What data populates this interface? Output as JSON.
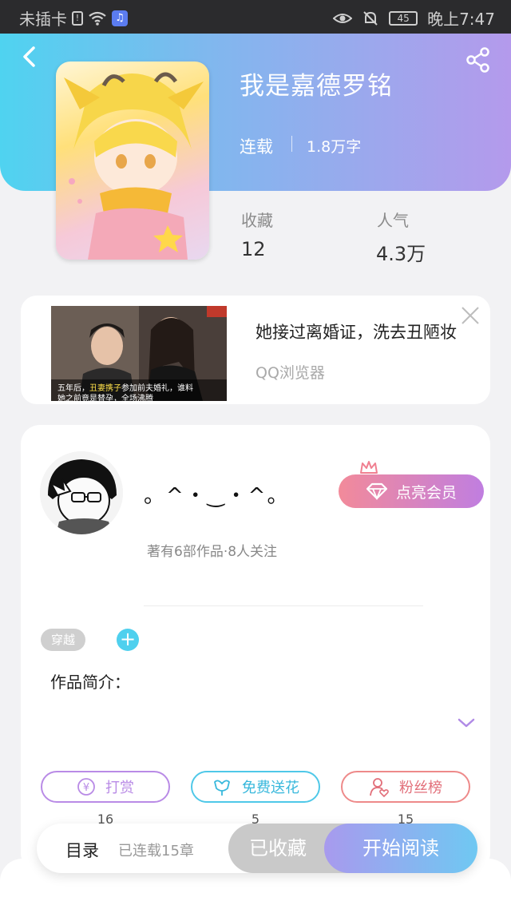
{
  "status_bar": {
    "carrier": "未插卡",
    "battery": "45",
    "time": "晚上7:47"
  },
  "book": {
    "title": "我是嘉德罗铭",
    "status": "连载",
    "word_count": "1.8万字",
    "favorites_label": "收藏",
    "favorites_value": "12",
    "popularity_label": "人气",
    "popularity_value": "4.3万"
  },
  "ad": {
    "headline": "她接过离婚证，洗去丑陋妆",
    "source": "QQ浏览器",
    "caption_line1_a": "五年后，",
    "caption_line1_b": "丑妻携子",
    "caption_line1_c": "参加前夫婚礼，谁料",
    "caption_line2": "她之前竟是替孕，全场沸腾"
  },
  "author": {
    "name": "。^・‿・^。",
    "meta": "著有6部作品·8人关注",
    "vip_label": "点亮会员"
  },
  "tags": [
    "穿越"
  ],
  "intro_label": "作品简介：",
  "actions": [
    {
      "label": "打赏",
      "count": "16",
      "color": "#b98be6"
    },
    {
      "label": "免费送花",
      "count": "5",
      "color": "#4fc8e8"
    },
    {
      "label": "粉丝榜",
      "count": "15",
      "color": "#ee8a8a"
    }
  ],
  "bottom": {
    "toc_label": "目录",
    "chapter_count": "已连载15章",
    "collected_label": "已收藏",
    "read_label": "开始阅读"
  }
}
